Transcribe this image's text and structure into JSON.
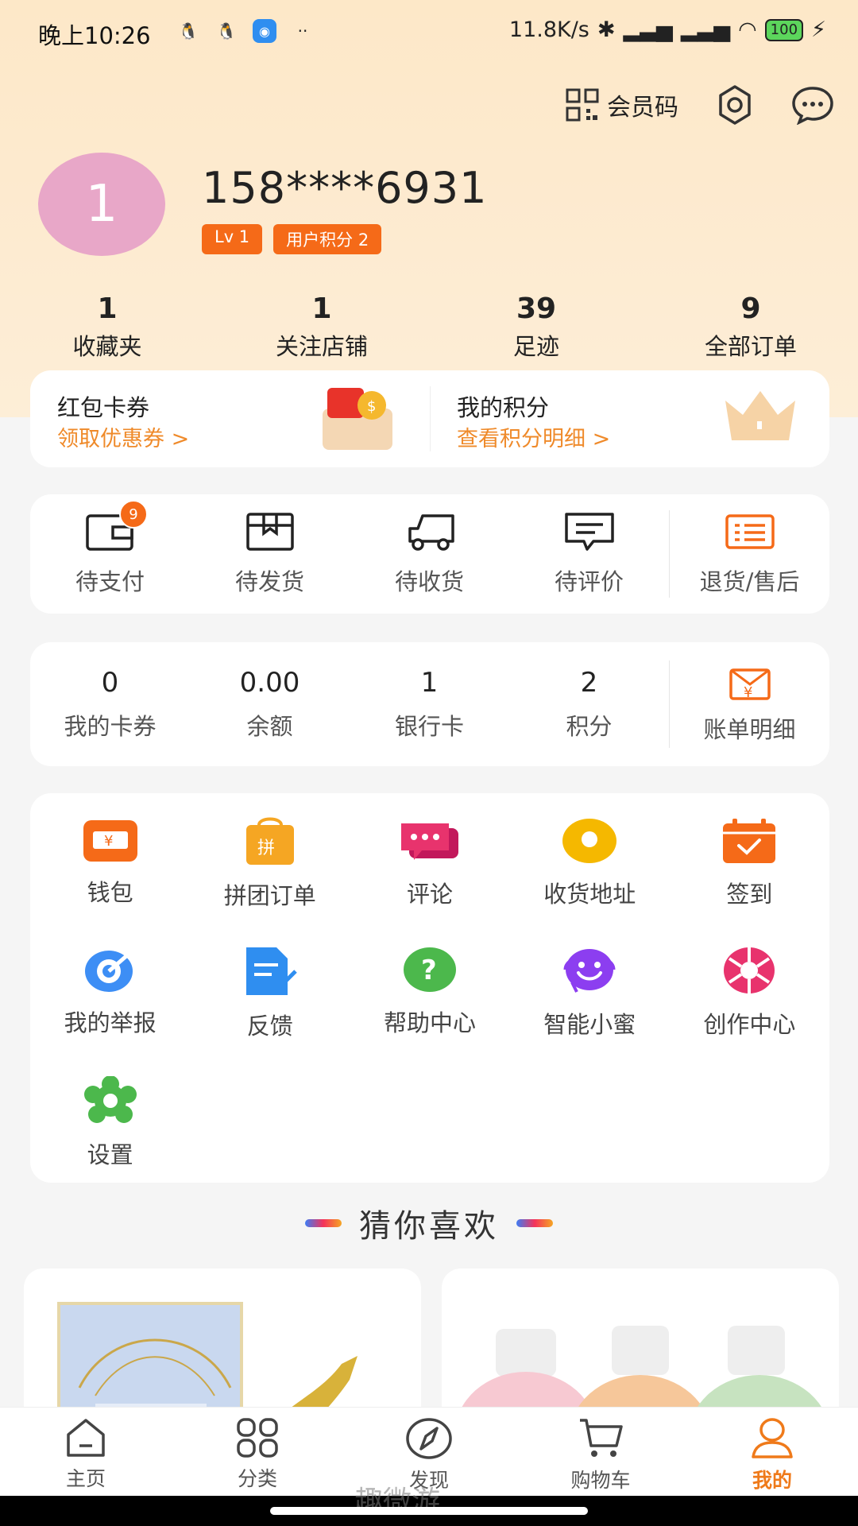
{
  "status_bar": {
    "time": "晚上10:26",
    "net_speed": "11.8K/s",
    "battery": "100"
  },
  "header": {
    "member_code_label": "会员码"
  },
  "profile": {
    "avatar_text": "1",
    "phone": "158****6931",
    "level": "Lv 1",
    "points_badge": "用户积分 2"
  },
  "stats": [
    {
      "value": "1",
      "label": "收藏夹"
    },
    {
      "value": "1",
      "label": "关注店铺"
    },
    {
      "value": "39",
      "label": "足迹"
    },
    {
      "value": "9",
      "label": "全部订单"
    }
  ],
  "coupon": {
    "left_title": "红包卡券",
    "left_link": "领取优惠券 >",
    "right_title": "我的积分",
    "right_link": "查看积分明细 >"
  },
  "orders": {
    "items": [
      {
        "label": "待支付",
        "icon": "wallet-icon",
        "badge": "9"
      },
      {
        "label": "待发货",
        "icon": "box-icon"
      },
      {
        "label": "待收货",
        "icon": "truck-icon"
      },
      {
        "label": "待评价",
        "icon": "comment-icon"
      },
      {
        "label": "退货/售后",
        "icon": "return-list-icon"
      }
    ]
  },
  "wallet": {
    "items": [
      {
        "value": "0",
        "label": "我的卡券"
      },
      {
        "value": "0.00",
        "label": "余额"
      },
      {
        "value": "1",
        "label": "银行卡"
      },
      {
        "value": "2",
        "label": "积分"
      }
    ],
    "bill_label": "账单明细"
  },
  "services": [
    {
      "label": "钱包",
      "icon": "wallet-icon",
      "color": "#f56a18"
    },
    {
      "label": "拼团订单",
      "icon": "group-bag-icon",
      "color": "#f5a623"
    },
    {
      "label": "评论",
      "icon": "chat-icon",
      "color": "#e8336d"
    },
    {
      "label": "收货地址",
      "icon": "location-icon",
      "color": "#f5b800"
    },
    {
      "label": "签到",
      "icon": "calendar-check-icon",
      "color": "#f56a18"
    },
    {
      "label": "我的举报",
      "icon": "target-icon",
      "color": "#3d8ef5"
    },
    {
      "label": "反馈",
      "icon": "document-edit-icon",
      "color": "#2f8ef0"
    },
    {
      "label": "帮助中心",
      "icon": "help-icon",
      "color": "#4cb84c"
    },
    {
      "label": "智能小蜜",
      "icon": "smiley-headset-icon",
      "color": "#8c3ef0"
    },
    {
      "label": "创作中心",
      "icon": "aperture-icon",
      "color": "#e8336d"
    },
    {
      "label": "设置",
      "icon": "gear-flower-icon",
      "color": "#4cb84c"
    }
  ],
  "guess": {
    "title": "猜你喜欢"
  },
  "tabbar": [
    {
      "label": "主页",
      "icon": "home-icon"
    },
    {
      "label": "分类",
      "icon": "category-icon"
    },
    {
      "label": "发现",
      "icon": "compass-icon"
    },
    {
      "label": "购物车",
      "icon": "cart-icon"
    },
    {
      "label": "我的",
      "icon": "person-icon",
      "active": true
    }
  ],
  "watermark": "趣微游",
  "colors": {
    "accent": "#f56a18",
    "link": "#ef8a2a",
    "header_bg": "#fde8c8"
  }
}
